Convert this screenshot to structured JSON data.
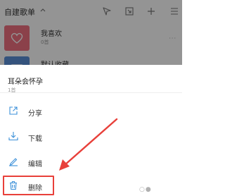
{
  "background": {
    "header_title": "自建歌单",
    "playlists": [
      {
        "name": "我喜欢",
        "count": "0首"
      },
      {
        "name": "默认收藏",
        "count": ""
      }
    ],
    "more_symbol": "···"
  },
  "sheet": {
    "title": "耳朵会怀孕",
    "subtitle": "1首",
    "items": [
      {
        "label": "分享",
        "icon": "share-icon"
      },
      {
        "label": "下载",
        "icon": "download-icon"
      },
      {
        "label": "编辑",
        "icon": "edit-icon"
      },
      {
        "label": "删除",
        "icon": "trash-icon"
      }
    ]
  },
  "colors": {
    "accent": "#3a8fd8",
    "highlight": "#e8403a",
    "thumb_pink": "#f07080",
    "thumb_blue": "#5b8fd8"
  },
  "watermark": "○●"
}
